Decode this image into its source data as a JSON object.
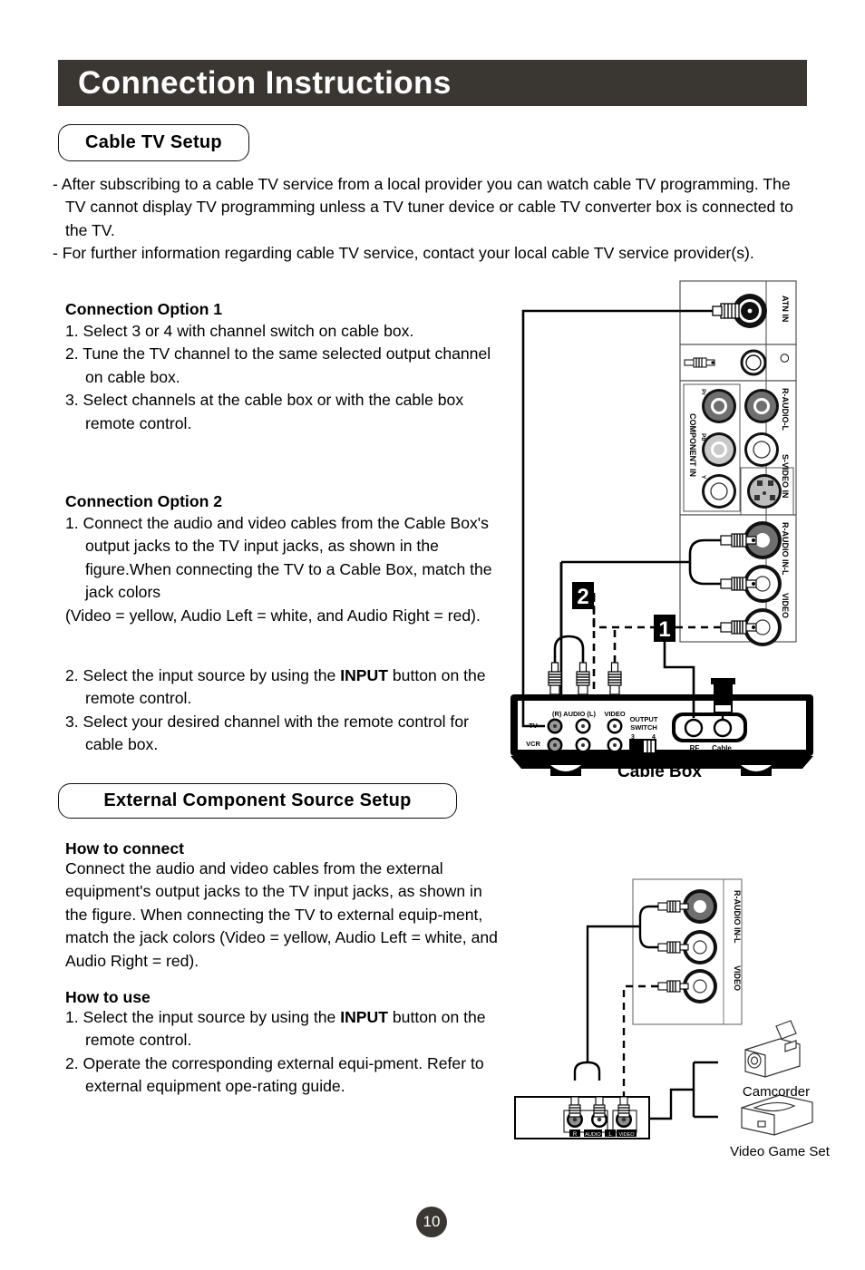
{
  "header": {
    "title": "Connection Instructions"
  },
  "sections": {
    "cable_tv": {
      "heading": "Cable TV Setup"
    },
    "external": {
      "heading": "External Component Source Setup"
    }
  },
  "intro": {
    "bullet1": "- After subscribing to a cable TV service from a local provider you can watch cable TV programming. The TV cannot display TV programming unless a TV tuner device or cable TV converter box is connected to the TV.",
    "bullet2": "- For further information regarding cable TV service, contact your local cable TV service provider(s)."
  },
  "option1": {
    "heading": "Connection Option 1",
    "steps": [
      "1. Select 3 or 4 with channel switch on cable box.",
      "2. Tune the TV channel to the same selected output channel on cable box.",
      "3. Select channels at the cable box or with the cable box remote control."
    ]
  },
  "option2": {
    "heading": "Connection Option 2",
    "step1": "1. Connect the audio and video cables from the Cable Box's output jacks to the TV input jacks, as shown in the figure.When connecting the TV to a Cable Box, match the jack colors",
    "step1b": "(Video = yellow, Audio Left = white, and Audio Right = red).",
    "step2_pre": "2. Select the input source by using the ",
    "step2_bold": "INPUT",
    "step2_post": " button on the remote control.",
    "step3": "3. Select your desired channel with the remote control for cable box."
  },
  "external": {
    "how_to_connect_heading": "How to connect",
    "how_to_connect_body": "Connect the audio and video cables from the external equipment's output jacks to the TV input jacks, as shown in the figure. When connecting the TV to external equip-ment, match the jack colors (Video = yellow, Audio Left = white, and Audio Right = red).",
    "how_to_use_heading": "How to use",
    "use_step1_pre": "1. Select the input source by using the ",
    "use_step1_bold": "INPUT",
    "use_step1_post": " button on the remote control.",
    "use_step2": "2. Operate the corresponding external equi-pment. Refer to external equipment ope-rating guide."
  },
  "figure_cable": {
    "badge1": "1",
    "badge2": "2",
    "caption": "Cable Box",
    "tv_panel_labels": {
      "antenna": "ATN IN",
      "component_in": "COMPONENT IN",
      "pr": "Pr",
      "pb": "Pb",
      "y": "Y",
      "r_audio_l": "R-AUDIO-L",
      "s_video_in": "S-VIDEO IN",
      "r_audio_in_l": "R-AUDIO IN-L",
      "video": "VIDEO"
    },
    "cable_box_labels": {
      "audio": "(R) AUDIO (L)",
      "video": "VIDEO",
      "tv": "TV",
      "vcr": "VCR",
      "output_switch": "OUTPUT",
      "output_switch2": "SWITCH",
      "sw3": "3",
      "sw4": "4",
      "rf": "RF",
      "cable": "Cable"
    }
  },
  "figure_external": {
    "panel_labels": {
      "r_audio_in_l": "R-AUDIO IN-L",
      "video": "VIDEO"
    },
    "device_jack_labels": {
      "r": "R",
      "audio": "AUDIO",
      "l": "L",
      "video": "VIDEO"
    },
    "camcorder": "Camcorder",
    "video_game_set": "Video Game Set"
  },
  "page_number": "10",
  "colors": {
    "header_bg": "#3a3733",
    "header_text": "#ffffff",
    "body_text": "#000000",
    "jack_dark": "#6f6f6f",
    "jack_light": "#c9c9c9",
    "jack_white": "#ffffff"
  }
}
